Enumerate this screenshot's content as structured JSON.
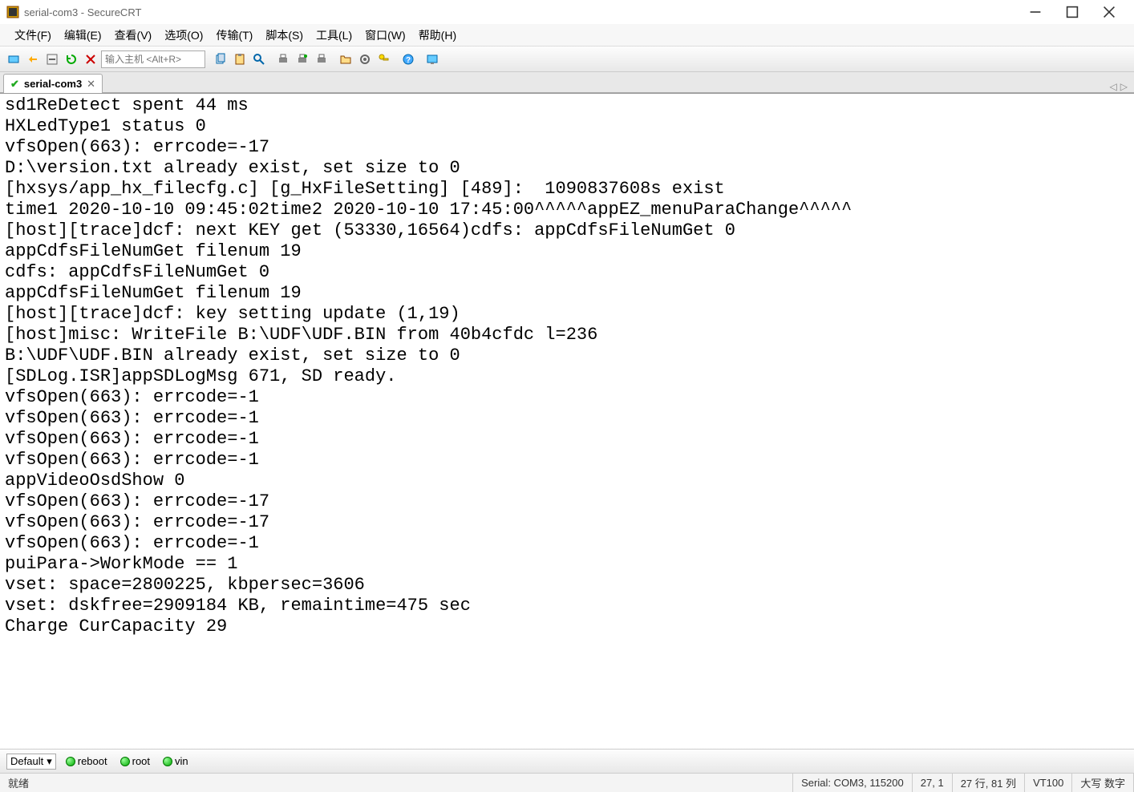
{
  "window": {
    "title": "serial-com3 - SecureCRT"
  },
  "menus": {
    "file": "文件(F)",
    "edit": "编辑(E)",
    "view": "查看(V)",
    "options": "选项(O)",
    "transfer": "传输(T)",
    "script": "脚本(S)",
    "tools": "工具(L)",
    "window": "窗口(W)",
    "help": "帮助(H)"
  },
  "toolbar": {
    "host_placeholder": "输入主机 <Alt+R>"
  },
  "tab": {
    "name": "serial-com3"
  },
  "terminal_lines": [
    "sd1ReDetect spent 44 ms",
    "HXLedType1 status 0",
    "vfsOpen(663): errcode=-17",
    "D:\\version.txt already exist, set size to 0",
    "[hxsys/app_hx_filecfg.c] [g_HxFileSetting] [489]:  1090837608s exist",
    "time1 2020-10-10 09:45:02time2 2020-10-10 17:45:00^^^^^appEZ_menuParaChange^^^^^",
    "[host][trace]dcf: next KEY get (53330,16564)cdfs: appCdfsFileNumGet 0",
    "appCdfsFileNumGet filenum 19",
    "cdfs: appCdfsFileNumGet 0",
    "appCdfsFileNumGet filenum 19",
    "[host][trace]dcf: key setting update (1,19)",
    "[host]misc: WriteFile B:\\UDF\\UDF.BIN from 40b4cfdc l=236",
    "B:\\UDF\\UDF.BIN already exist, set size to 0",
    "[SDLog.ISR]appSDLogMsg 671, SD ready.",
    "vfsOpen(663): errcode=-1",
    "vfsOpen(663): errcode=-1",
    "vfsOpen(663): errcode=-1",
    "vfsOpen(663): errcode=-1",
    "appVideoOsdShow 0",
    "vfsOpen(663): errcode=-17",
    "vfsOpen(663): errcode=-17",
    "vfsOpen(663): errcode=-1",
    "puiPara->WorkMode == 1",
    "vset: space=2800225, kbpersec=3606",
    "vset: dskfree=2909184 KB, remaintime=475 sec",
    "Charge CurCapacity 29"
  ],
  "quickbar": {
    "default_label": "Default",
    "reboot": "reboot",
    "root": "root",
    "vin": "vin"
  },
  "status": {
    "ready": "就绪",
    "conn": "Serial: COM3, 115200",
    "pos": "27,  1",
    "size": "27 行, 81 列",
    "emu": "VT100",
    "caps": "大写 数字"
  }
}
